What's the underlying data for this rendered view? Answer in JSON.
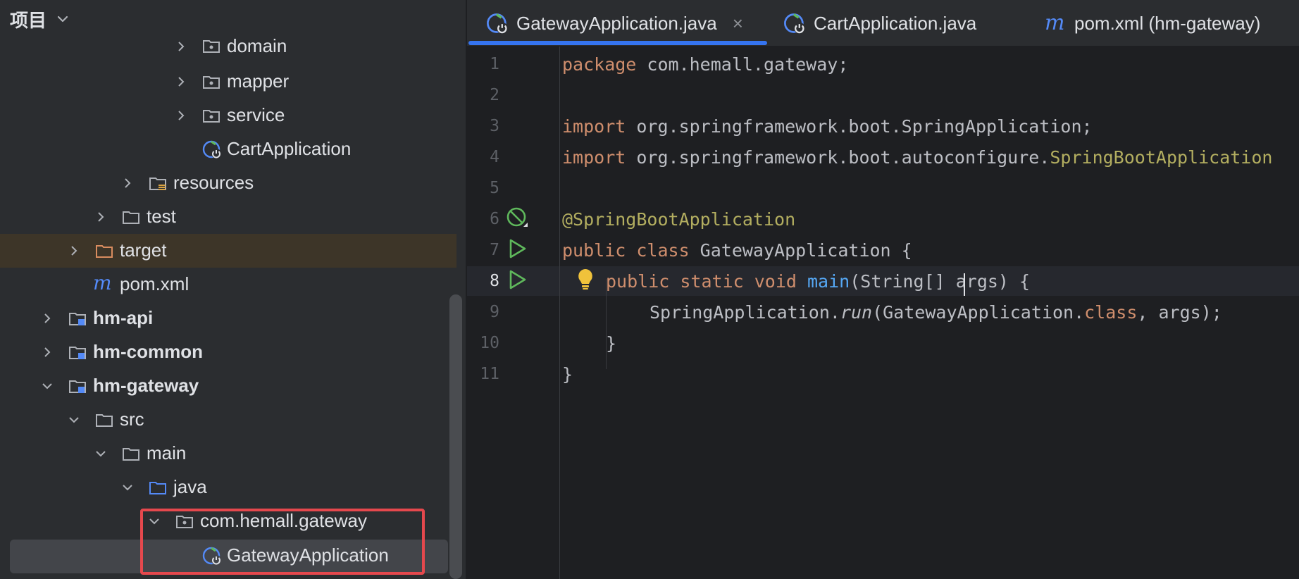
{
  "project_panel": {
    "title": "项目",
    "tree": [
      {
        "label": "domain",
        "kind": "package",
        "expandable": true,
        "expanded": false,
        "bold": false
      },
      {
        "label": "mapper",
        "kind": "package",
        "expandable": true,
        "expanded": false,
        "bold": false
      },
      {
        "label": "service",
        "kind": "package",
        "expandable": true,
        "expanded": false,
        "bold": false
      },
      {
        "label": "CartApplication",
        "kind": "spring-class",
        "expandable": false,
        "bold": false
      },
      {
        "label": "resources",
        "kind": "resources-folder",
        "expandable": true,
        "expanded": false,
        "bold": false
      },
      {
        "label": "test",
        "kind": "folder",
        "expandable": true,
        "expanded": false,
        "bold": false
      },
      {
        "label": "target",
        "kind": "excluded-folder",
        "expandable": true,
        "expanded": false,
        "bold": false
      },
      {
        "label": "pom.xml",
        "kind": "maven-file",
        "expandable": false,
        "bold": false
      },
      {
        "label": "hm-api",
        "kind": "module",
        "expandable": true,
        "expanded": false,
        "bold": true
      },
      {
        "label": "hm-common",
        "kind": "module",
        "expandable": true,
        "expanded": false,
        "bold": true
      },
      {
        "label": "hm-gateway",
        "kind": "module",
        "expandable": true,
        "expanded": true,
        "bold": true
      },
      {
        "label": "src",
        "kind": "folder",
        "expandable": true,
        "expanded": true,
        "bold": false
      },
      {
        "label": "main",
        "kind": "folder",
        "expandable": true,
        "expanded": true,
        "bold": false
      },
      {
        "label": "java",
        "kind": "source-folder",
        "expandable": true,
        "expanded": true,
        "bold": false
      },
      {
        "label": "com.hemall.gateway",
        "kind": "package",
        "expandable": true,
        "expanded": true,
        "bold": false
      },
      {
        "label": "GatewayApplication",
        "kind": "spring-class",
        "expandable": false,
        "bold": false,
        "selected": true
      }
    ]
  },
  "editor": {
    "tabs": [
      {
        "label": "GatewayApplication.java",
        "icon": "spring-class-icon",
        "active": true,
        "close": "×"
      },
      {
        "label": "CartApplication.java",
        "icon": "spring-class-icon",
        "active": false
      },
      {
        "label": "pom.xml (hm-gateway)",
        "icon": "maven-icon",
        "active": false
      }
    ],
    "line_numbers": [
      "1",
      "2",
      "3",
      "4",
      "5",
      "6",
      "7",
      "8",
      "9",
      "10",
      "11"
    ],
    "current_line": "8",
    "gutter_icons": [
      {
        "line": "6",
        "icon": "no-bean-icon"
      },
      {
        "line": "7",
        "icon": "run-icon"
      },
      {
        "line": "8",
        "icon": "run-icon"
      }
    ],
    "code": {
      "l1_kw": "package",
      "l1_rest": " com.hemall.gateway;",
      "l3_kw": "import",
      "l3_rest": " org.springframework.boot.SpringApplication;",
      "l4_kw": "import",
      "l4_rest": " org.springframework.boot.autoconfigure.",
      "l4_ann": "SpringBootApplication",
      "l6_ann": "@SpringBootApplication",
      "l7_kw": "public class",
      "l7_rest": " GatewayApplication {",
      "l8_kw": "public static void",
      "l8_fn": "main",
      "l8_rest": "(String[] args)",
      "l8_tail": " {",
      "l9_a": "SpringApplication.",
      "l9_it": "run",
      "l9_b": "(GatewayApplication.",
      "l9_kw": "class",
      "l9_c": ", args);",
      "l10": "}",
      "l11": "}"
    }
  },
  "colors": {
    "accent": "#3574f0",
    "highlight_box": "#e5484d",
    "keyword": "#cf8e6d",
    "annotation": "#b3ae60",
    "function": "#56a8f5"
  }
}
